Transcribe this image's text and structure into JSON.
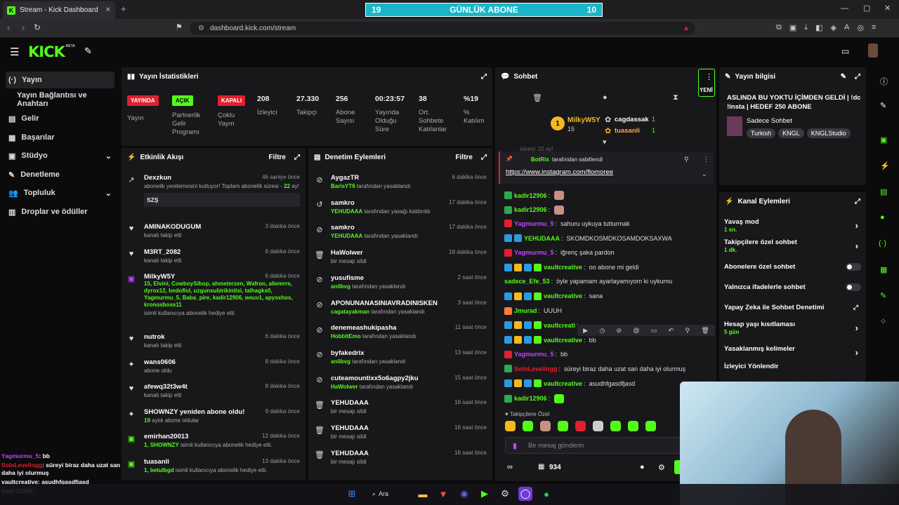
{
  "browser": {
    "tab_title": "Stream - Kick Dashboard",
    "url": "dashboard.kick.com/stream",
    "sub_goal": {
      "left": "19",
      "label": "GÜNLÜK ABONE",
      "right": "10"
    }
  },
  "kick": {
    "logo": "KICK",
    "beta": "BETA"
  },
  "sidebar": {
    "items": [
      {
        "label": "Yayın",
        "icon": "broadcast-icon"
      },
      {
        "label": "Yayın Bağlantısı ve Anahtarı",
        "icon": ""
      },
      {
        "label": "Gelir",
        "icon": "wallet-icon"
      },
      {
        "label": "Başarılar",
        "icon": "grid-icon"
      },
      {
        "label": "Stüdyo",
        "icon": "studio-icon"
      },
      {
        "label": "Denetleme",
        "icon": "wrench-icon"
      },
      {
        "label": "Topluluk",
        "icon": "users-icon"
      },
      {
        "label": "Droplar ve ödüller",
        "icon": "chart-icon"
      }
    ]
  },
  "stats": {
    "title": "Yayın İstatistikleri",
    "items": [
      {
        "badge": "YAYINDA",
        "label": "Yayın",
        "color": "#e0202e"
      },
      {
        "badge": "AÇIK",
        "label": "Partnerlik Gelir Programı",
        "color": "#53fc18"
      },
      {
        "badge": "KAPALI",
        "label": "Çoklu Yayın",
        "color": "#e0202e"
      },
      {
        "value": "208",
        "label": "İzleyici"
      },
      {
        "value": "27.330",
        "label": "Takipçi"
      },
      {
        "value": "256",
        "label": "Abone Sayısı"
      },
      {
        "value": "00:23:57",
        "label": "Yayında Olduğu Süre"
      },
      {
        "value": "38",
        "label": "Ort. Sohbete Katılanlar"
      },
      {
        "value": "%19",
        "label": "% Katılım"
      }
    ]
  },
  "activity": {
    "title": "Etkinlik Akışı",
    "filter": "Filtre",
    "events": [
      {
        "name": "Dexzkun",
        "time": "46 saniye önce",
        "sub": "abonelik yenilemesini kutluyor! Toplam abonelik süresi - ",
        "sub_highlight": "22",
        "sub_tail": " ay!",
        "message": "SZŞ"
      },
      {
        "name": "AMINAKODUGUM",
        "time": "3 dakika önce",
        "sub": "kanalı takip etti"
      },
      {
        "name": "M3RT_2082",
        "time": "6 dakika önce",
        "sub": "kanalı takip etti"
      },
      {
        "name": "MilkyW5Y",
        "time": "6 dakika önce",
        "gift_list": "15, Elvini, CowboySibop, ahmeterzen, Wafron, aliemrre, dyrox12, bedoflol, uzgunsubirikintisi, talhagks0, Yagmurmu_5, Baba_pire, kadir12906, weuv1, apysxhos, kronosboss11",
        "sub": "isimli kullanıcıya abonelik hediye etti."
      },
      {
        "name": "nutrok",
        "time": "6 dakika önce",
        "sub": "kanalı takip etti"
      },
      {
        "name": "wans0606",
        "time": "8 dakika önce",
        "sub": "abone oldu"
      },
      {
        "name": "afewq32t3w4t",
        "time": "8 dakika önce",
        "sub": "kanalı takip etti"
      },
      {
        "name": "SHOWNZY yeniden abone oldu!",
        "time": "9 dakika önce",
        "sub_highlight": "19",
        "sub": " aylık abone oldular"
      },
      {
        "name": "emirhan20013",
        "time": "12 dakika önce",
        "sub_highlight": "1, SHOWNZY",
        "sub": " isimli kullanıcıya abonelik hediye etti."
      },
      {
        "name": "tuasanli",
        "time": "13 dakika önce",
        "sub_highlight": "1, betulbgd",
        "sub": " isimli kullanıcıya abonelik hediye etti."
      }
    ]
  },
  "moderation": {
    "title": "Denetim Eylemleri",
    "filter": "Filtre",
    "actions": [
      {
        "user": "AygazTR",
        "time": "6 dakika önce",
        "mod": "BarisYT6",
        "action": "tarafından yasaklandı"
      },
      {
        "user": "samkro",
        "time": "17 dakika önce",
        "mod": "YEHUDAAA",
        "action": "tarafından yasağı kaldırıldı"
      },
      {
        "user": "samkro",
        "time": "17 dakika önce",
        "mod": "YEHUDAAA",
        "action": "tarafından yasaklandı"
      },
      {
        "user": "HaWolwer",
        "time": "18 dakika önce",
        "mod": "",
        "action": "bir mesajı sildi"
      },
      {
        "user": "yusufisme",
        "time": "2 saat önce",
        "mod": "anilbvg",
        "action": "tarafından yasaklandı"
      },
      {
        "user": "APONUNANASINIAVRADINISKEN",
        "time": "3 saat önce",
        "mod": "cagatayakman",
        "action": "tarafından yasaklandı"
      },
      {
        "user": "denemeashukipasha",
        "time": "11 saat önce",
        "mod": "HobbitEmo",
        "action": "tarafından yasaklandı"
      },
      {
        "user": "byfakedrix",
        "time": "13 saat önce",
        "mod": "anilbvg",
        "action": "tarafından yasaklandı"
      },
      {
        "user": "cuteamountixx5o6agpy2jku",
        "time": "15 saat önce",
        "mod": "HaWolwer",
        "action": "tarafından yasaklandı"
      },
      {
        "user": "YEHUDAAA",
        "time": "16 saat önce",
        "mod": "",
        "action": "bir mesajı sildi"
      },
      {
        "user": "YEHUDAAA",
        "time": "16 saat önce",
        "mod": "",
        "action": "bir mesajı sildi"
      },
      {
        "user": "YEHUDAAA",
        "time": "16 saat önce",
        "mod": "",
        "action": "bir mesajı sildi"
      }
    ]
  },
  "chat": {
    "title": "Sohbet",
    "new_label": "YENİ",
    "gifter": {
      "name": "MilkyW5Y",
      "count": "15",
      "rank": "1"
    },
    "leaders": [
      {
        "name": "cagdassak",
        "count": "1"
      },
      {
        "name": "tuasanli",
        "count": "1"
      }
    ],
    "faded": "süresi: 22 ay!",
    "pinned": {
      "by": "BotRix",
      "by_suffix": "tarafından sabitlendi",
      "link": "https://www.instagram.com/flomoree"
    },
    "messages": [
      {
        "user": "kadir12906",
        "color": "#53fc18",
        "text": ""
      },
      {
        "user": "kadir12906",
        "color": "#53fc18",
        "text": ""
      },
      {
        "user": "Yagmurmu_5",
        "color": "#c044ff",
        "text": "sahuru uykuya tutturmak"
      },
      {
        "user": "YEHUDAAA",
        "color": "#53fc18",
        "text": "SKOMDKOSMDKOSAMDOKSAXWA"
      },
      {
        "user": "Yagmurmu_5",
        "color": "#c044ff",
        "text": "iğrenç şaka pardon"
      },
      {
        "user": "vaultcreative",
        "color": "#53fc18",
        "text": "oo abone mi geldi"
      },
      {
        "user": "sadece_Efe_53",
        "color": "#53fc18",
        "text": "öyle yapamam ayarlayamıyom ki uykumu"
      },
      {
        "user": "vaultcreative",
        "color": "#53fc18",
        "text": "sana"
      },
      {
        "user": "Jmurad",
        "color": "#53fc18",
        "text": "UUUH"
      },
      {
        "user": "vaultcreati",
        "color": "#53fc18",
        "text": ""
      },
      {
        "user": "vaultcreative",
        "color": "#53fc18",
        "text": "bb"
      },
      {
        "user": "Yagmurmu_5",
        "color": "#c044ff",
        "text": "bb"
      },
      {
        "user": "SoloLevelingg",
        "color": "#e0202e",
        "text": "süreyi biraz daha uzat san daha iyi olurmuş"
      },
      {
        "user": "vaultcreative",
        "color": "#53fc18",
        "text": "asudhfgasdfjasd"
      },
      {
        "user": "kadir12906",
        "color": "#53fc18",
        "text": ""
      }
    ],
    "followers_only": "Takipçilere Özel",
    "placeholder": "Bir mesaj gönderin",
    "points": "934"
  },
  "stream_info": {
    "title": "Yayın bilgisi",
    "stream_title": "ASLINDA BU YOKTU İÇİMDEN GELDİ | !dc !insta | HEDEF 250 ABONE",
    "category": "Sadece Sohbet",
    "tags": [
      "Turkish",
      "KNGL",
      "KNGLStudio"
    ]
  },
  "channel_actions": {
    "title": "Kanal Eylemleri",
    "items": [
      {
        "label": "Yavaş mod",
        "sub": "1 sn.",
        "type": "arrow"
      },
      {
        "label": "Takipçilere özel sohbet",
        "sub": "1 dk.",
        "type": "arrow"
      },
      {
        "label": "Abonelere özel sohbet",
        "sub": "",
        "type": "toggle"
      },
      {
        "label": "Yalnızca ifadelerle sohbet",
        "sub": "",
        "type": "toggle"
      },
      {
        "label": "Yapay Zeka ile Sohbet Denetimi",
        "sub": "",
        "type": "external"
      },
      {
        "label": "Hesap yaşı kısıtlaması",
        "sub": "5 gün",
        "type": "arrow"
      },
      {
        "label": "Yasaklanmış kelimeler",
        "sub": "",
        "type": "arrow"
      },
      {
        "label": "İzleyici Yönlendir",
        "sub": "",
        "type": "none"
      }
    ]
  },
  "overlay_chat": [
    {
      "user": "Yagmurmu_5",
      "text": "bb",
      "color": "#c044ff"
    },
    {
      "user": "SoloLevelingg",
      "text": "süreyi biraz daha uzat san daha iyi olurmuş",
      "color": "#e0202e"
    },
    {
      "user": "vaultcreative",
      "text": "asudhfgasdfjasd",
      "color": "#ffffff"
    },
    {
      "user": "kadir12906",
      "text": "",
      "color": "#ffffff"
    }
  ],
  "taskbar": {
    "search": "Ara"
  },
  "colors": {
    "brand": "#53fc18",
    "panel": "#18181b",
    "danger": "#e0202e"
  }
}
